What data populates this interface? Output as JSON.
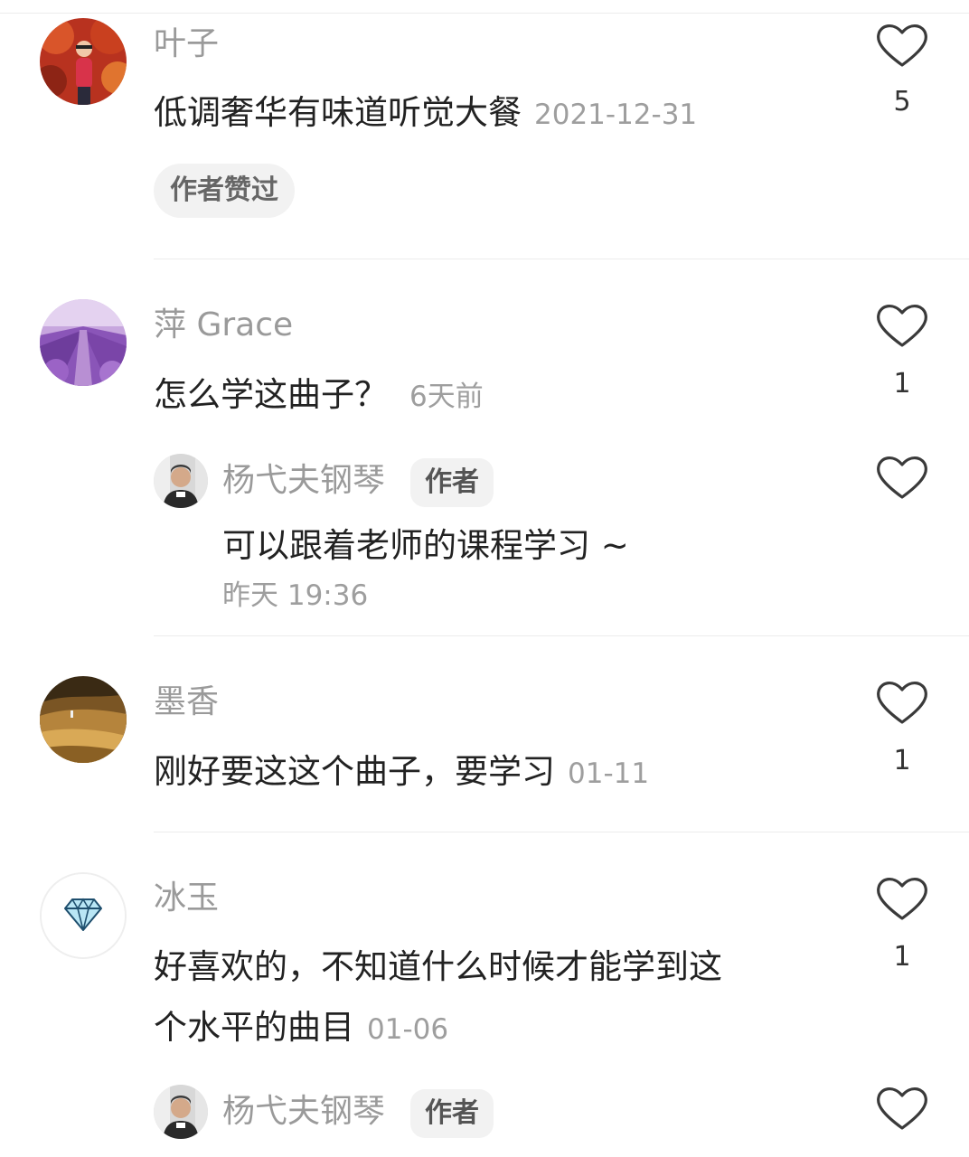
{
  "comments": [
    {
      "username": "叶子",
      "text": "低调奢华有味道听觉大餐",
      "time": "2021-12-31",
      "likes": "5",
      "badge": "作者赞过",
      "avatar_icon": "person-red-foliage-avatar"
    },
    {
      "username": "萍 Grace",
      "text": "怎么学这曲子？",
      "time": "6天前",
      "likes": "1",
      "avatar_icon": "lavender-field-avatar",
      "reply": {
        "username": "杨弋夫钢琴",
        "badge": "作者",
        "text": "可以跟着老师的课程学习 ~",
        "time": "昨天 19:36",
        "avatar_icon": "man-portrait-avatar"
      }
    },
    {
      "username": "墨香",
      "text": "刚好要这这个曲子，要学习",
      "time": "01-11",
      "likes": "1",
      "avatar_icon": "desert-dunes-avatar"
    },
    {
      "username": "冰玉",
      "text_line1": "好喜欢的，不知道什么时候才能学到这",
      "text_line2": "个水平的曲目",
      "time": "01-06",
      "likes": "1",
      "avatar_icon": "diamond-avatar",
      "reply": {
        "username": "杨弋夫钢琴",
        "badge": "作者",
        "avatar_icon": "man-portrait-avatar"
      }
    }
  ],
  "colors": {
    "username": "#9a9a9a",
    "text": "#222222",
    "time": "#9e9e9e",
    "badge_bg": "#f2f2f2",
    "like_icon": "#3a3a3a"
  }
}
